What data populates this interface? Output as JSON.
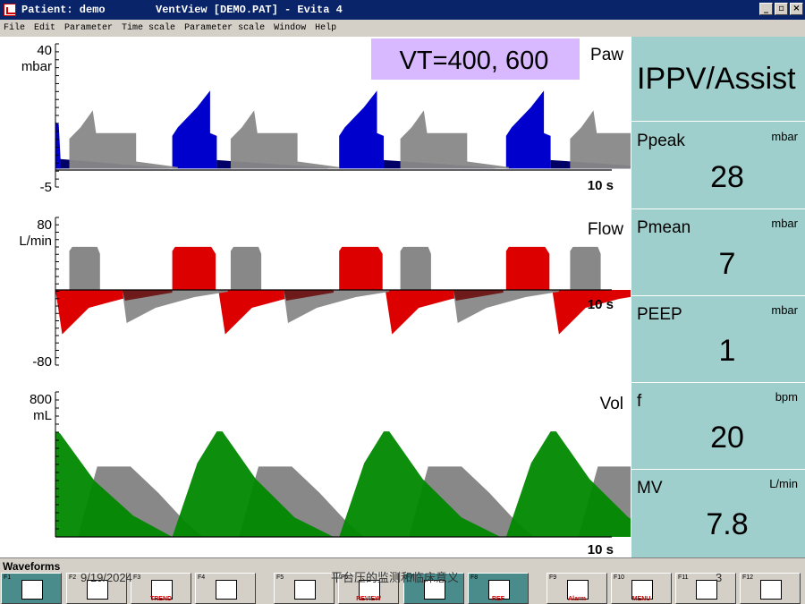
{
  "window": {
    "patient": "Patient: demo",
    "title": "VentView [DEMO.PAT] - Evita 4",
    "controls": [
      "_",
      "▫",
      "×"
    ]
  },
  "menu": [
    "File",
    "Edit",
    "Parameter",
    "Time scale",
    "Parameter scale",
    "Window",
    "Help"
  ],
  "annotation": "VT=400, 600",
  "charts": {
    "paw": {
      "label": "Paw",
      "unit": "mbar",
      "ymax": "40",
      "ymin": "-5",
      "time": "10 s"
    },
    "flow": {
      "label": "Flow",
      "unit": "L/min",
      "ymax": "80",
      "ymin": "-80",
      "time": "10 s"
    },
    "vol": {
      "label": "Vol",
      "unit": "mL",
      "ymax": "800",
      "ymin": "",
      "time": "10 s"
    }
  },
  "chart_data": [
    {
      "type": "area",
      "name": "Paw",
      "ylim": [
        -5,
        40
      ],
      "xlim_s": 10,
      "series": [
        {
          "color": "#0000cc",
          "breaths": [
            {
              "start": 0.0,
              "peak": 10
            },
            {
              "start": 2.1,
              "peak": 28
            },
            {
              "start": 5.1,
              "peak": 27
            },
            {
              "start": 8.1,
              "peak": 28
            }
          ]
        },
        {
          "color": "#888888",
          "breaths": [
            {
              "start": 0.25,
              "peak": 21
            },
            {
              "start": 3.15,
              "peak": 21
            },
            {
              "start": 6.2,
              "peak": 21
            },
            {
              "start": 9.25,
              "peak": 21
            }
          ]
        }
      ]
    },
    {
      "type": "area",
      "name": "Flow",
      "ylim": [
        -80,
        80
      ],
      "xlim_s": 10,
      "series": [
        {
          "color": "#dd0000",
          "insp_peak": 30,
          "exp_peak": -37
        },
        {
          "color": "#888888",
          "insp_peak": 30,
          "exp_peak": -28
        }
      ]
    },
    {
      "type": "area",
      "name": "Vol",
      "ylim": [
        0,
        800
      ],
      "xlim_s": 10,
      "series": [
        {
          "color": "#008800",
          "peak_ml": 600
        },
        {
          "color": "#888888",
          "peak_ml": 400
        }
      ]
    }
  ],
  "mode": "IPPV/Assist",
  "params": [
    {
      "name": "Ppeak",
      "unit": "mbar",
      "value": "28"
    },
    {
      "name": "Pmean",
      "unit": "mbar",
      "value": "7"
    },
    {
      "name": "PEEP",
      "unit": "mbar",
      "value": "1"
    },
    {
      "name": "f",
      "unit": "bpm",
      "value": "20"
    },
    {
      "name": "MV",
      "unit": "L/min",
      "value": "7.8"
    }
  ],
  "statusbar": {
    "label": "Waveforms",
    "fkeys": [
      "F1",
      "F2",
      "F3",
      "F4",
      "F5",
      "F6",
      "F7",
      "F8",
      "F9",
      "F10",
      "F11",
      "F12"
    ],
    "fkey_texts": {
      "F3": "TREND",
      "F6": "REVIEW",
      "F8": "REF",
      "F9": "Alarm",
      "F10": "MENU"
    }
  },
  "overlay": {
    "date": "9/19/2024",
    "doc_title": "平台压的监测和临床意义",
    "page": "3"
  },
  "colors": {
    "titlebar": "#0a246a",
    "panel": "#9fcfcc",
    "annotation_bg": "#d8b8ff",
    "paw_fill": "#0000cc",
    "flow_fill": "#dd0000",
    "vol_fill": "#008800",
    "compare_fill": "#888888"
  }
}
